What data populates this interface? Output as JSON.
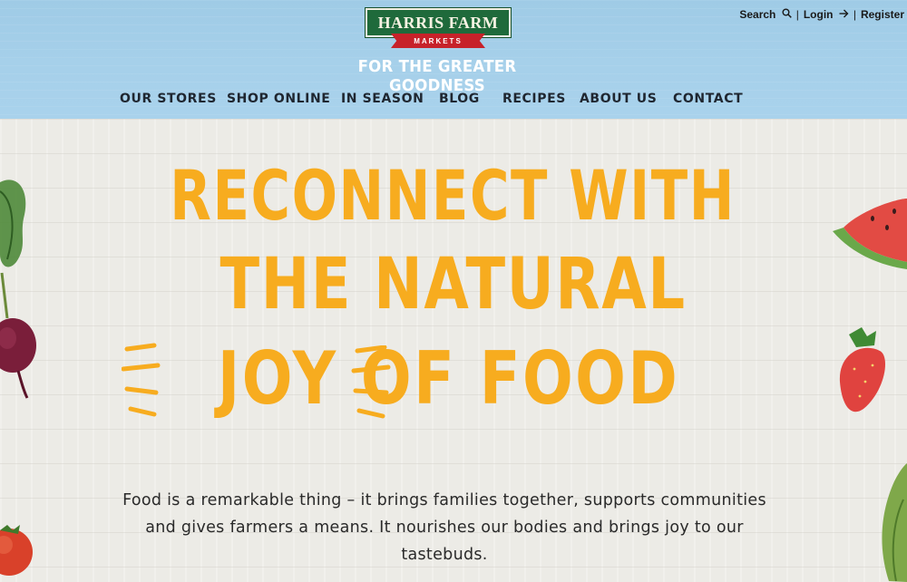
{
  "brand": {
    "name": "HARRIS FARM",
    "sub": "MARKETS",
    "tagline": "FOR THE GREATER GOODNESS",
    "green": "#1f6a3b",
    "red": "#c7222a"
  },
  "utility": {
    "search": "Search",
    "login": "Login",
    "register": "Register",
    "separator": "|"
  },
  "nav": {
    "items": [
      {
        "label": "OUR STORES"
      },
      {
        "label": "SHOP ONLINE"
      },
      {
        "label": "IN SEASON"
      },
      {
        "label": "BLOG"
      },
      {
        "label": "RECIPES"
      },
      {
        "label": "ABOUT US"
      },
      {
        "label": "CONTACT"
      }
    ]
  },
  "hero": {
    "line1": "RECONNECT WITH",
    "line2": "THE NATURAL",
    "line3": "JOY OF FOOD",
    "headline_color": "#f7ac1f",
    "body": "Food is a remarkable thing – it brings families together, supports communities and gives farmers a means. It nourishes our bodies and brings joy to our tastebuds."
  },
  "icons": {
    "search": "search-icon",
    "login": "arrow-right-icon"
  },
  "colors": {
    "header_bg": "#a6d0ea",
    "hero_bg": "#ecebe6",
    "nav_text": "#1f2630"
  }
}
